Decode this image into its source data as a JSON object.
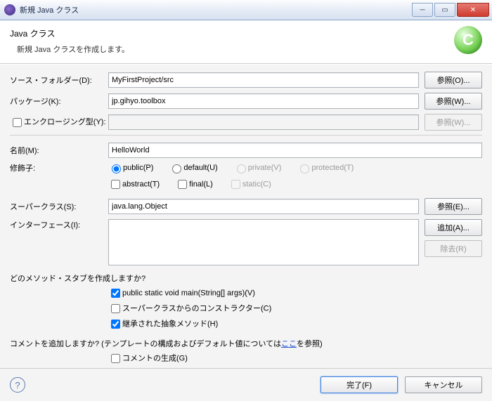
{
  "window": {
    "title": "新規 Java クラス"
  },
  "banner": {
    "heading": "Java クラス",
    "sub": "新規 Java クラスを作成します。"
  },
  "labels": {
    "sourceFolder": "ソース・フォルダー(D):",
    "package": "パッケージ(K):",
    "enclosing": "エンクロージング型(Y):",
    "name": "名前(M):",
    "modifiers": "修飾子:",
    "superclass": "スーパークラス(S):",
    "interfaces": "インターフェース(I):",
    "stubsQ": "どのメソッド・スタブを作成しますか?",
    "commentsQ": "コメントを追加しますか? (テンプレートの構成およびデフォルト値については",
    "commentsHere": "ここ",
    "commentsTail": "を参照)"
  },
  "values": {
    "sourceFolder": "MyFirstProject/src",
    "package": "jp.gihyo.toolbox",
    "enclosing": "",
    "name": "HelloWorld",
    "superclass": "java.lang.Object"
  },
  "modifiers": {
    "public": "public(P)",
    "default": "default(U)",
    "private": "private(V)",
    "protected": "protected(T)",
    "abstract": "abstract(T)",
    "final": "final(L)",
    "static": "static(C)"
  },
  "buttons": {
    "browseO": "参照(O)...",
    "browseW": "参照(W)...",
    "browseW2": "参照(W)...",
    "browseE": "参照(E)...",
    "addA": "追加(A)...",
    "removeR": "除去(R)",
    "finish": "完了(F)",
    "cancel": "キャンセル"
  },
  "stubs": {
    "main": "public static void main(String[] args)(V)",
    "superCtor": "スーパークラスからのコンストラクター(C)",
    "inherited": "継承された抽象メソッド(H)"
  },
  "comments": {
    "gen": "コメントの生成(G)"
  }
}
